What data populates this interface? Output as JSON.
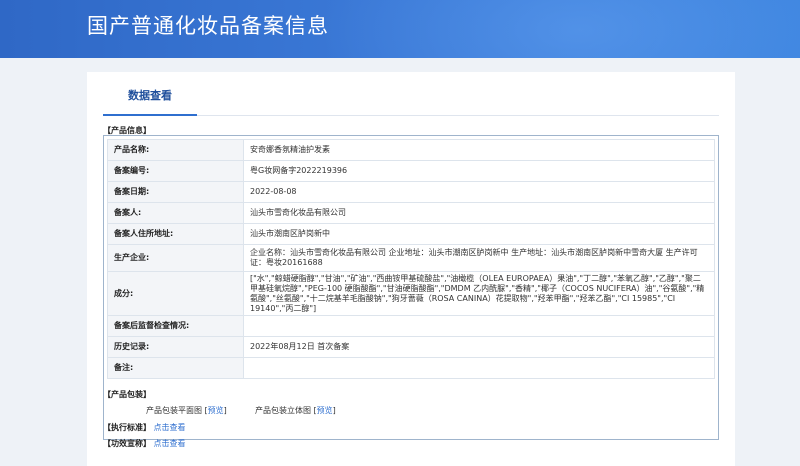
{
  "header": {
    "title": "国产普通化妆品备案信息"
  },
  "tabs": [
    {
      "label": "数据查看"
    }
  ],
  "product_info": {
    "section_title": "【产品信息】",
    "rows": [
      {
        "label": "产品名称:",
        "value": "安奇娜香氛精油护发素"
      },
      {
        "label": "备案编号:",
        "value": "粤G妆网备字2022219396"
      },
      {
        "label": "备案日期:",
        "value": "2022-08-08"
      },
      {
        "label": "备案人:",
        "value": "汕头市雪奇化妆品有限公司"
      },
      {
        "label": "备案人住所地址:",
        "value": "汕头市潮南区胪岗新中"
      },
      {
        "label": "生产企业:",
        "value": "企业名称：汕头市雪奇化妆品有限公司 企业地址：汕头市潮南区胪岗新中 生产地址：汕头市潮南区胪岗新中雪奇大厦 生产许可证：粤妆20161688"
      },
      {
        "label": "成分:",
        "value": "[\"水\",\"鲸蜡硬脂醇\",\"甘油\",\"矿油\",\"西曲铵甲基硫酸盐\",\"油橄榄（OLEA EUROPAEA）果油\",\"丁二醇\",\"苯氧乙醇\",\"乙醇\",\"聚二甲基硅氧烷醇\",\"PEG-100 硬脂酸酯\",\"甘油硬脂酸酯\",\"DMDM 乙内酰脲\",\"香精\",\"椰子（COCOS NUCIFERA）油\",\"谷氨酸\",\"精氨酸\",\"丝氨酸\",\"十二烷基羊毛脂酸钠\",\"狗牙蔷薇（ROSA CANINA）花提取物\",\"羟苯甲酯\",\"羟苯乙酯\",\"CI 15985\",\"CI 19140\",\"丙二醇\"]"
      },
      {
        "label": "备案后监督检查情况:",
        "value": ""
      },
      {
        "label": "历史记录:",
        "value": "2022年08月12日 首次备案"
      },
      {
        "label": "备注:",
        "value": ""
      }
    ]
  },
  "packaging": {
    "section_title": "【产品包装】",
    "items": [
      {
        "label": "产品包装平面图",
        "link": "预览"
      },
      {
        "label": "产品包装立体图",
        "link": "预览"
      }
    ],
    "bracket_open": "[",
    "bracket_close": "]"
  },
  "standard": {
    "label": "【执行标准】",
    "link": "点击查看"
  },
  "efficacy": {
    "label": "【功效宣称】",
    "link": "点击查看"
  },
  "colors": {
    "header": "#3a78d6",
    "accent": "#2f6fcf",
    "border": "#9fb4cc"
  }
}
